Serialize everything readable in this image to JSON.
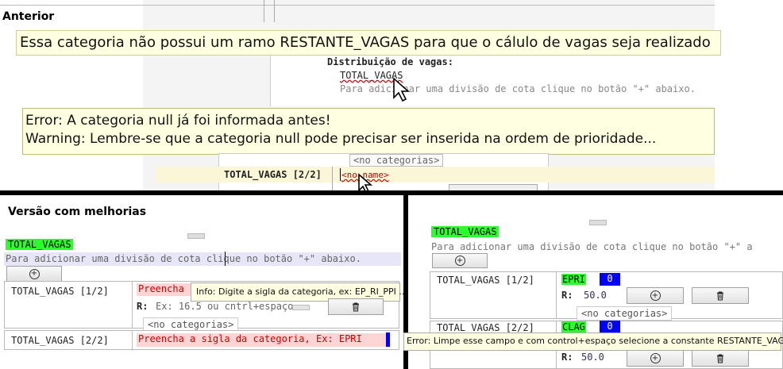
{
  "top": {
    "title": "Anterior",
    "banner_warning": "Essa categoria não possui um ramo RESTANTE_VAGAS para que o cálulo de vagas seja realizado",
    "distrib_label": "Distribuição de vagas:",
    "total_vagas": "TOTAL_VAGAS",
    "hint": "Para adicionar uma divisão de cota clique no botão \"+\" abaixo.",
    "tooltip_error": "Error: A categoria null já foi informada antes!",
    "tooltip_warning": "Warning: Lembre-se que a categoria null pode precisar ser inserida na ordem de prioridade...",
    "no_categorias": "<no categorias>",
    "row_label": "TOTAL_VAGAS [2/2]",
    "no_name": "<no name>"
  },
  "left": {
    "title": "Versão com melhorias",
    "total_vagas": "TOTAL_VAGAS",
    "hint": "Para adicionar uma divisão de cota clique no botão \"+\" abaixo.",
    "add_icon": "plus-circle-icon",
    "row1_label": "TOTAL_VAGAS [1/2]",
    "row1_value": "Preencha",
    "row1_tooltip": "Info: Digite a sigla da categoria, ex: EP_RI_PPI ...",
    "r_prefix": "R:",
    "r_placeholder": "Ex: 16.5 ou cntrl+espaço",
    "no_categorias": "<no categorias>",
    "row2_label": "TOTAL_VAGAS [2/2]",
    "row2_value": "Preencha a sigla da categoria, Ex: EPRI",
    "trash_icon": "trash-icon"
  },
  "right": {
    "total_vagas": "TOTAL_VAGAS",
    "hint": "Para adicionar uma divisão de cota clique no botão \"+\" a",
    "row1_label": "TOTAL_VAGAS [1/2]",
    "row1_cat": "EPRI",
    "row1_count": "0",
    "r_prefix": "R:",
    "row1_r": "50.0",
    "no_categorias": "<no categorias>",
    "row2_label": "TOTAL_VAGAS [2/2]",
    "row2_cat": "CLAG",
    "row2_count": "0",
    "row2_r": "50.0",
    "error_tooltip": "Error: Limpe esse campo e com control+espaço selecione a constante RESTANTE_VAGAS"
  },
  "colors": {
    "green": "#2aff2a",
    "blue": "#0000ff",
    "tooltip": "#ffffe1",
    "error": "#cc0000"
  }
}
